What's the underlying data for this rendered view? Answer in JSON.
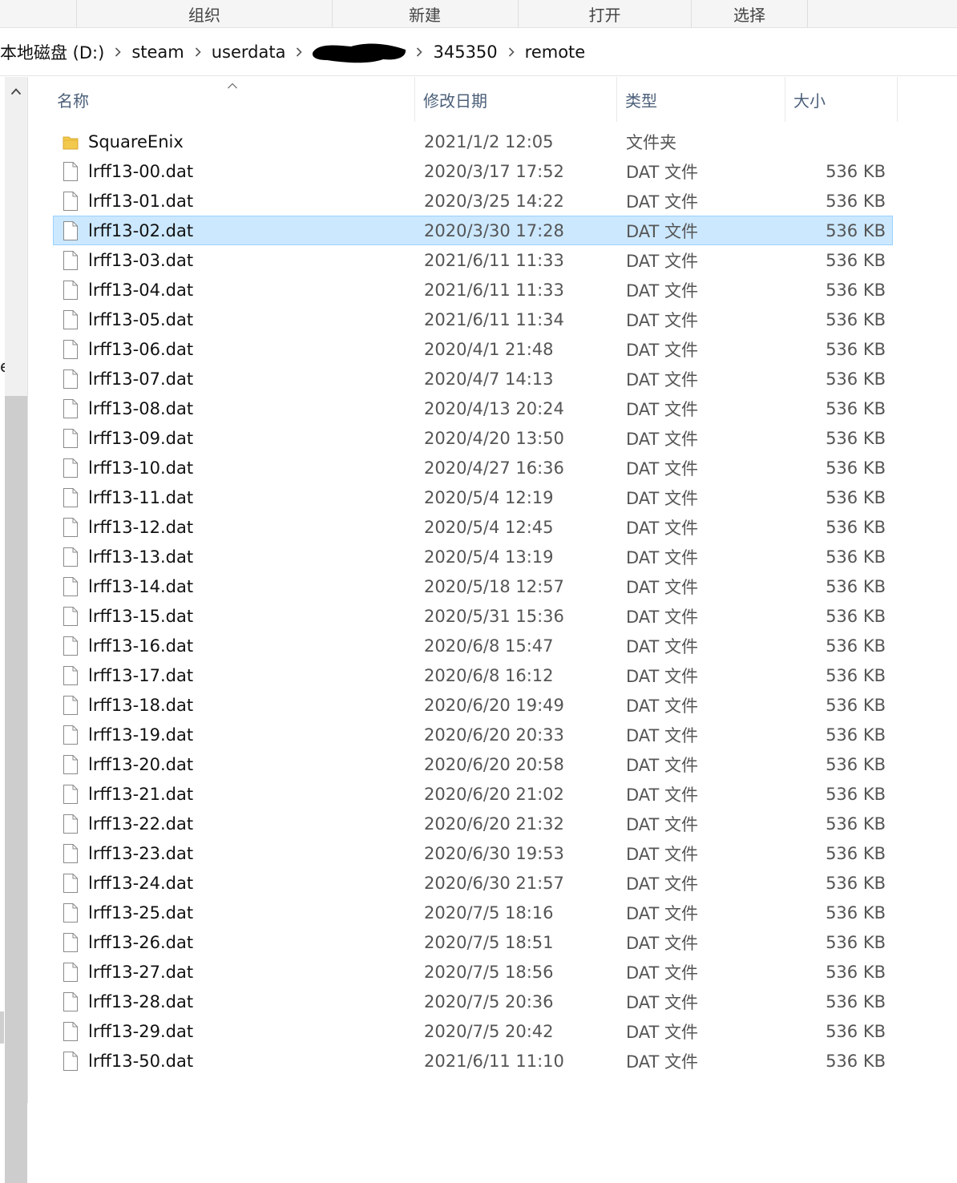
{
  "ribbon": {
    "groups": [
      "组织",
      "新建",
      "打开",
      "选择"
    ]
  },
  "address": {
    "crumbs": [
      "本地磁盘 (D:)",
      "steam",
      "userdata",
      "",
      "345350",
      "remote"
    ]
  },
  "nav_edge_text": "e",
  "columns": {
    "name": "名称",
    "date": "修改日期",
    "type": "类型",
    "size": "大小"
  },
  "colors": {
    "selected_bg": "#cce8ff",
    "selected_border": "#99d1ff",
    "folder": "#f2c94c",
    "header_text": "#4c607a"
  },
  "files": [
    {
      "name": "SquareEnix",
      "date": "2021/1/2 12:05",
      "type": "文件夹",
      "size": "",
      "icon": "folder-icon"
    },
    {
      "name": "lrff13-00.dat",
      "date": "2020/3/17 17:52",
      "type": "DAT 文件",
      "size": "536 KB",
      "icon": "file-icon"
    },
    {
      "name": "lrff13-01.dat",
      "date": "2020/3/25 14:22",
      "type": "DAT 文件",
      "size": "536 KB",
      "icon": "file-icon"
    },
    {
      "name": "lrff13-02.dat",
      "date": "2020/3/30 17:28",
      "type": "DAT 文件",
      "size": "536 KB",
      "icon": "file-icon",
      "selected": true
    },
    {
      "name": "lrff13-03.dat",
      "date": "2021/6/11 11:33",
      "type": "DAT 文件",
      "size": "536 KB",
      "icon": "file-icon"
    },
    {
      "name": "lrff13-04.dat",
      "date": "2021/6/11 11:33",
      "type": "DAT 文件",
      "size": "536 KB",
      "icon": "file-icon"
    },
    {
      "name": "lrff13-05.dat",
      "date": "2021/6/11 11:34",
      "type": "DAT 文件",
      "size": "536 KB",
      "icon": "file-icon"
    },
    {
      "name": "lrff13-06.dat",
      "date": "2020/4/1 21:48",
      "type": "DAT 文件",
      "size": "536 KB",
      "icon": "file-icon"
    },
    {
      "name": "lrff13-07.dat",
      "date": "2020/4/7 14:13",
      "type": "DAT 文件",
      "size": "536 KB",
      "icon": "file-icon"
    },
    {
      "name": "lrff13-08.dat",
      "date": "2020/4/13 20:24",
      "type": "DAT 文件",
      "size": "536 KB",
      "icon": "file-icon"
    },
    {
      "name": "lrff13-09.dat",
      "date": "2020/4/20 13:50",
      "type": "DAT 文件",
      "size": "536 KB",
      "icon": "file-icon"
    },
    {
      "name": "lrff13-10.dat",
      "date": "2020/4/27 16:36",
      "type": "DAT 文件",
      "size": "536 KB",
      "icon": "file-icon"
    },
    {
      "name": "lrff13-11.dat",
      "date": "2020/5/4 12:19",
      "type": "DAT 文件",
      "size": "536 KB",
      "icon": "file-icon"
    },
    {
      "name": "lrff13-12.dat",
      "date": "2020/5/4 12:45",
      "type": "DAT 文件",
      "size": "536 KB",
      "icon": "file-icon"
    },
    {
      "name": "lrff13-13.dat",
      "date": "2020/5/4 13:19",
      "type": "DAT 文件",
      "size": "536 KB",
      "icon": "file-icon"
    },
    {
      "name": "lrff13-14.dat",
      "date": "2020/5/18 12:57",
      "type": "DAT 文件",
      "size": "536 KB",
      "icon": "file-icon"
    },
    {
      "name": "lrff13-15.dat",
      "date": "2020/5/31 15:36",
      "type": "DAT 文件",
      "size": "536 KB",
      "icon": "file-icon"
    },
    {
      "name": "lrff13-16.dat",
      "date": "2020/6/8 15:47",
      "type": "DAT 文件",
      "size": "536 KB",
      "icon": "file-icon"
    },
    {
      "name": "lrff13-17.dat",
      "date": "2020/6/8 16:12",
      "type": "DAT 文件",
      "size": "536 KB",
      "icon": "file-icon"
    },
    {
      "name": "lrff13-18.dat",
      "date": "2020/6/20 19:49",
      "type": "DAT 文件",
      "size": "536 KB",
      "icon": "file-icon"
    },
    {
      "name": "lrff13-19.dat",
      "date": "2020/6/20 20:33",
      "type": "DAT 文件",
      "size": "536 KB",
      "icon": "file-icon"
    },
    {
      "name": "lrff13-20.dat",
      "date": "2020/6/20 20:58",
      "type": "DAT 文件",
      "size": "536 KB",
      "icon": "file-icon"
    },
    {
      "name": "lrff13-21.dat",
      "date": "2020/6/20 21:02",
      "type": "DAT 文件",
      "size": "536 KB",
      "icon": "file-icon"
    },
    {
      "name": "lrff13-22.dat",
      "date": "2020/6/20 21:32",
      "type": "DAT 文件",
      "size": "536 KB",
      "icon": "file-icon"
    },
    {
      "name": "lrff13-23.dat",
      "date": "2020/6/30 19:53",
      "type": "DAT 文件",
      "size": "536 KB",
      "icon": "file-icon"
    },
    {
      "name": "lrff13-24.dat",
      "date": "2020/6/30 21:57",
      "type": "DAT 文件",
      "size": "536 KB",
      "icon": "file-icon"
    },
    {
      "name": "lrff13-25.dat",
      "date": "2020/7/5 18:16",
      "type": "DAT 文件",
      "size": "536 KB",
      "icon": "file-icon"
    },
    {
      "name": "lrff13-26.dat",
      "date": "2020/7/5 18:51",
      "type": "DAT 文件",
      "size": "536 KB",
      "icon": "file-icon"
    },
    {
      "name": "lrff13-27.dat",
      "date": "2020/7/5 18:56",
      "type": "DAT 文件",
      "size": "536 KB",
      "icon": "file-icon"
    },
    {
      "name": "lrff13-28.dat",
      "date": "2020/7/5 20:36",
      "type": "DAT 文件",
      "size": "536 KB",
      "icon": "file-icon"
    },
    {
      "name": "lrff13-29.dat",
      "date": "2020/7/5 20:42",
      "type": "DAT 文件",
      "size": "536 KB",
      "icon": "file-icon"
    },
    {
      "name": "lrff13-50.dat",
      "date": "2021/6/11 11:10",
      "type": "DAT 文件",
      "size": "536 KB",
      "icon": "file-icon"
    }
  ]
}
